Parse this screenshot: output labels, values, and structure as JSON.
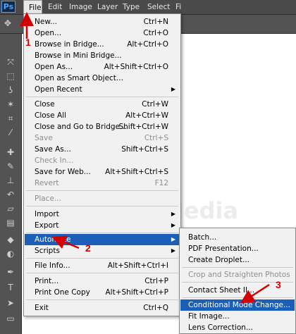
{
  "app": {
    "logo": "Ps"
  },
  "menubar": [
    {
      "label": "File",
      "active": true
    },
    {
      "label": "Edit"
    },
    {
      "label": "Image"
    },
    {
      "label": "Layer"
    },
    {
      "label": "Type"
    },
    {
      "label": "Select"
    },
    {
      "label": "Fi"
    }
  ],
  "file_menu": [
    {
      "label": "New...",
      "shortcut": "Ctrl+N"
    },
    {
      "label": "Open...",
      "shortcut": "Ctrl+O"
    },
    {
      "label": "Browse in Bridge...",
      "shortcut": "Alt+Ctrl+O"
    },
    {
      "label": "Browse in Mini Bridge...",
      "shortcut": ""
    },
    {
      "label": "Open As...",
      "shortcut": "Alt+Shift+Ctrl+O"
    },
    {
      "label": "Open as Smart Object...",
      "shortcut": ""
    },
    {
      "label": "Open Recent",
      "shortcut": "",
      "submenu": true
    },
    {
      "label": "Close",
      "shortcut": "Ctrl+W"
    },
    {
      "label": "Close All",
      "shortcut": "Alt+Ctrl+W"
    },
    {
      "label": "Close and Go to Bridge...",
      "shortcut": "Shift+Ctrl+W"
    },
    {
      "label": "Save",
      "shortcut": "Ctrl+S",
      "disabled": true
    },
    {
      "label": "Save As...",
      "shortcut": "Shift+Ctrl+S"
    },
    {
      "label": "Check In...",
      "shortcut": "",
      "disabled": true
    },
    {
      "label": "Save for Web...",
      "shortcut": "Alt+Shift+Ctrl+S"
    },
    {
      "label": "Revert",
      "shortcut": "F12",
      "disabled": true
    },
    {
      "label": "Place...",
      "shortcut": "",
      "disabled": true
    },
    {
      "label": "Import",
      "shortcut": "",
      "submenu": true
    },
    {
      "label": "Export",
      "shortcut": "",
      "submenu": true
    },
    {
      "label": "Automate",
      "shortcut": "",
      "submenu": true,
      "active": true
    },
    {
      "label": "Scripts",
      "shortcut": "",
      "submenu": true
    },
    {
      "label": "File Info...",
      "shortcut": "Alt+Shift+Ctrl+I"
    },
    {
      "label": "Print...",
      "shortcut": "Ctrl+P"
    },
    {
      "label": "Print One Copy",
      "shortcut": "Alt+Shift+Ctrl+P"
    },
    {
      "label": "Exit",
      "shortcut": "Ctrl+Q"
    }
  ],
  "automate_submenu": [
    {
      "label": "Batch..."
    },
    {
      "label": "PDF Presentation..."
    },
    {
      "label": "Create Droplet..."
    },
    {
      "label": "Crop and Straighten Photos",
      "disabled": true
    },
    {
      "label": "Contact Sheet II..."
    },
    {
      "label": "Conditional Mode Change...",
      "active": true
    },
    {
      "label": "Fit Image..."
    },
    {
      "label": "Lens Correction..."
    }
  ],
  "callouts": [
    "1",
    "2",
    "3"
  ],
  "watermark": "TermasMedia",
  "colors": {
    "highlight": "#1b5fb8",
    "callout": "#d40000"
  }
}
